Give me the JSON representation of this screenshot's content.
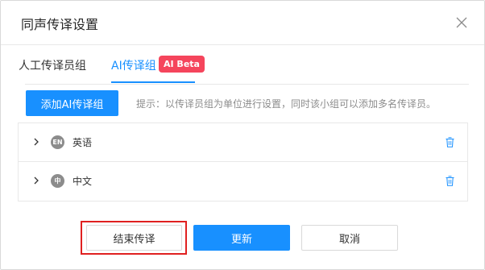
{
  "dialog": {
    "title": "同声传译设置",
    "close_icon": "close-icon"
  },
  "tabs": [
    {
      "label": "人工传译员组",
      "active": false
    },
    {
      "label": "AI传译组",
      "active": true,
      "badge": "AI Beta"
    }
  ],
  "toolbar": {
    "add_label": "添加AI传译组",
    "hint": "提示：以传译员组为单位进行设置，同时该小组可以添加多名传译员。"
  },
  "groups": [
    {
      "badge": "EN",
      "language": "英语",
      "expand_icon": "chevron-right-icon",
      "delete_icon": "trash-icon"
    },
    {
      "badge": "中",
      "language": "中文",
      "expand_icon": "chevron-right-icon",
      "delete_icon": "trash-icon"
    }
  ],
  "footer": {
    "end_label": "结束传译",
    "update_label": "更新",
    "cancel_label": "取消"
  },
  "colors": {
    "primary": "#1890ff",
    "beta_badge": "#f5455c",
    "highlight": "#e02020",
    "lang_badge": "#8c8c8c"
  }
}
